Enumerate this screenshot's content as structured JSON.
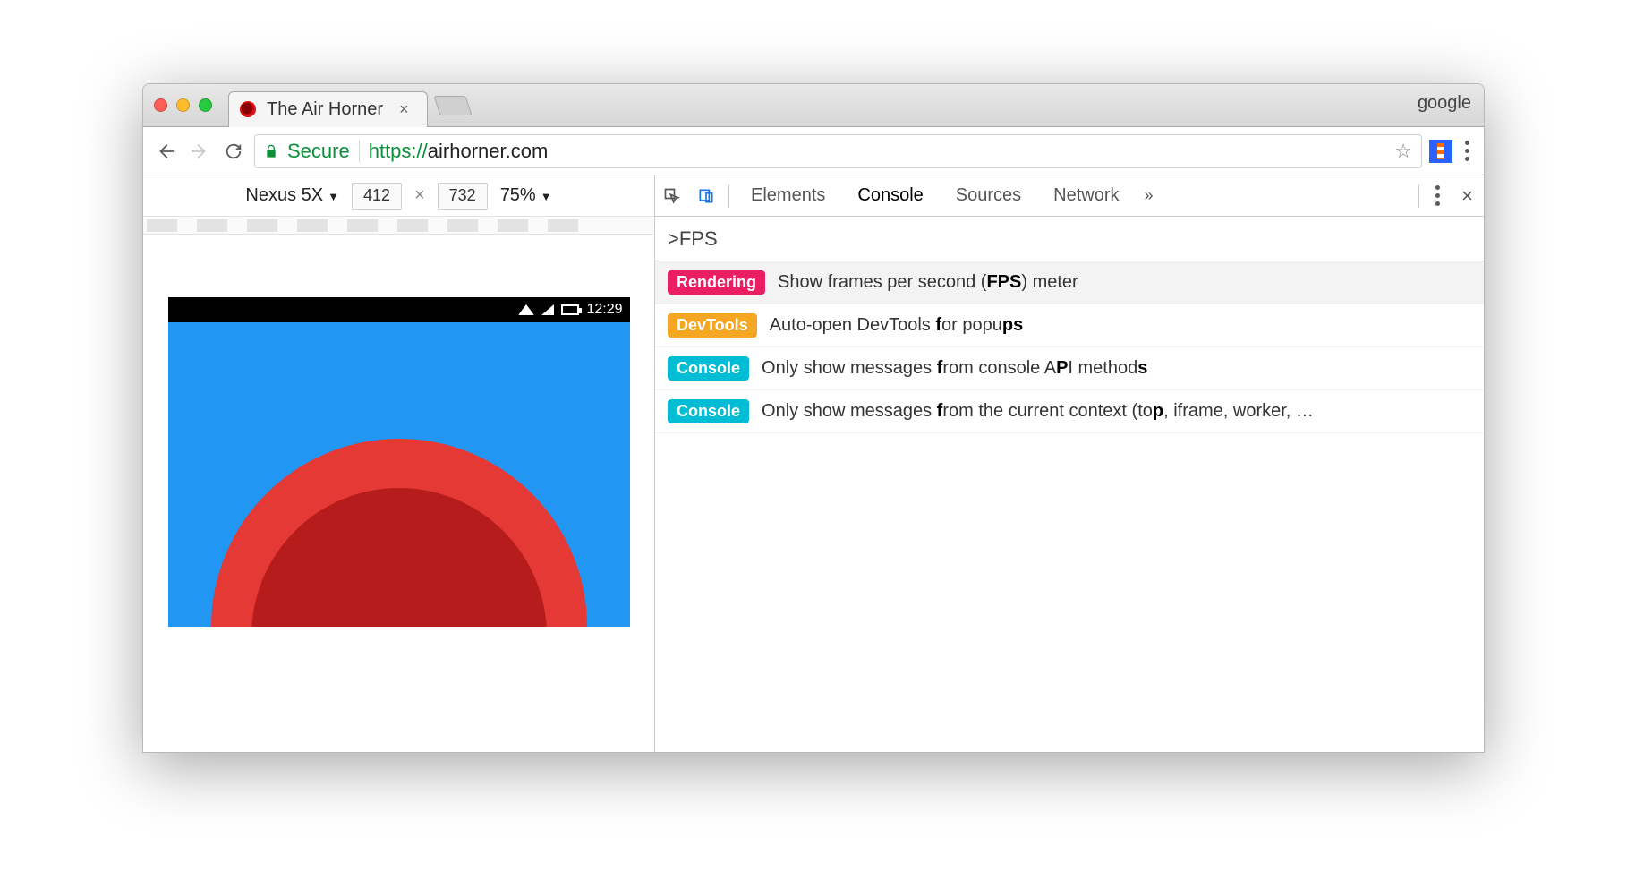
{
  "window": {
    "profile": "google",
    "tab_title": "The Air Horner"
  },
  "toolbar": {
    "secure_label": "Secure",
    "url_proto": "https://",
    "url_host": "airhorner.com"
  },
  "device_toolbar": {
    "device": "Nexus 5X",
    "width": "412",
    "height": "732",
    "zoom": "75%"
  },
  "statusbar": {
    "time": "12:29"
  },
  "devtools": {
    "tabs": [
      "Elements",
      "Console",
      "Sources",
      "Network"
    ],
    "active_tab": "Console",
    "overflow": "»"
  },
  "command_menu": {
    "query": ">FPS",
    "items": [
      {
        "badge": "Rendering",
        "badge_kind": "rendering",
        "text_html": "Show frames per second (<b>FPS</b>) meter",
        "selected": true
      },
      {
        "badge": "DevTools",
        "badge_kind": "devtools",
        "text_html": "Auto-open DevTools <b>f</b>or popu<b>ps</b>",
        "selected": false
      },
      {
        "badge": "Console",
        "badge_kind": "console",
        "text_html": "Only show messages <b>f</b>rom console A<b>P</b>I method<b>s</b>",
        "selected": false
      },
      {
        "badge": "Console",
        "badge_kind": "console",
        "text_html": "Only show messages <b>f</b>rom the current context (to<b>p</b>, iframe, worker, …",
        "selected": false
      }
    ]
  }
}
